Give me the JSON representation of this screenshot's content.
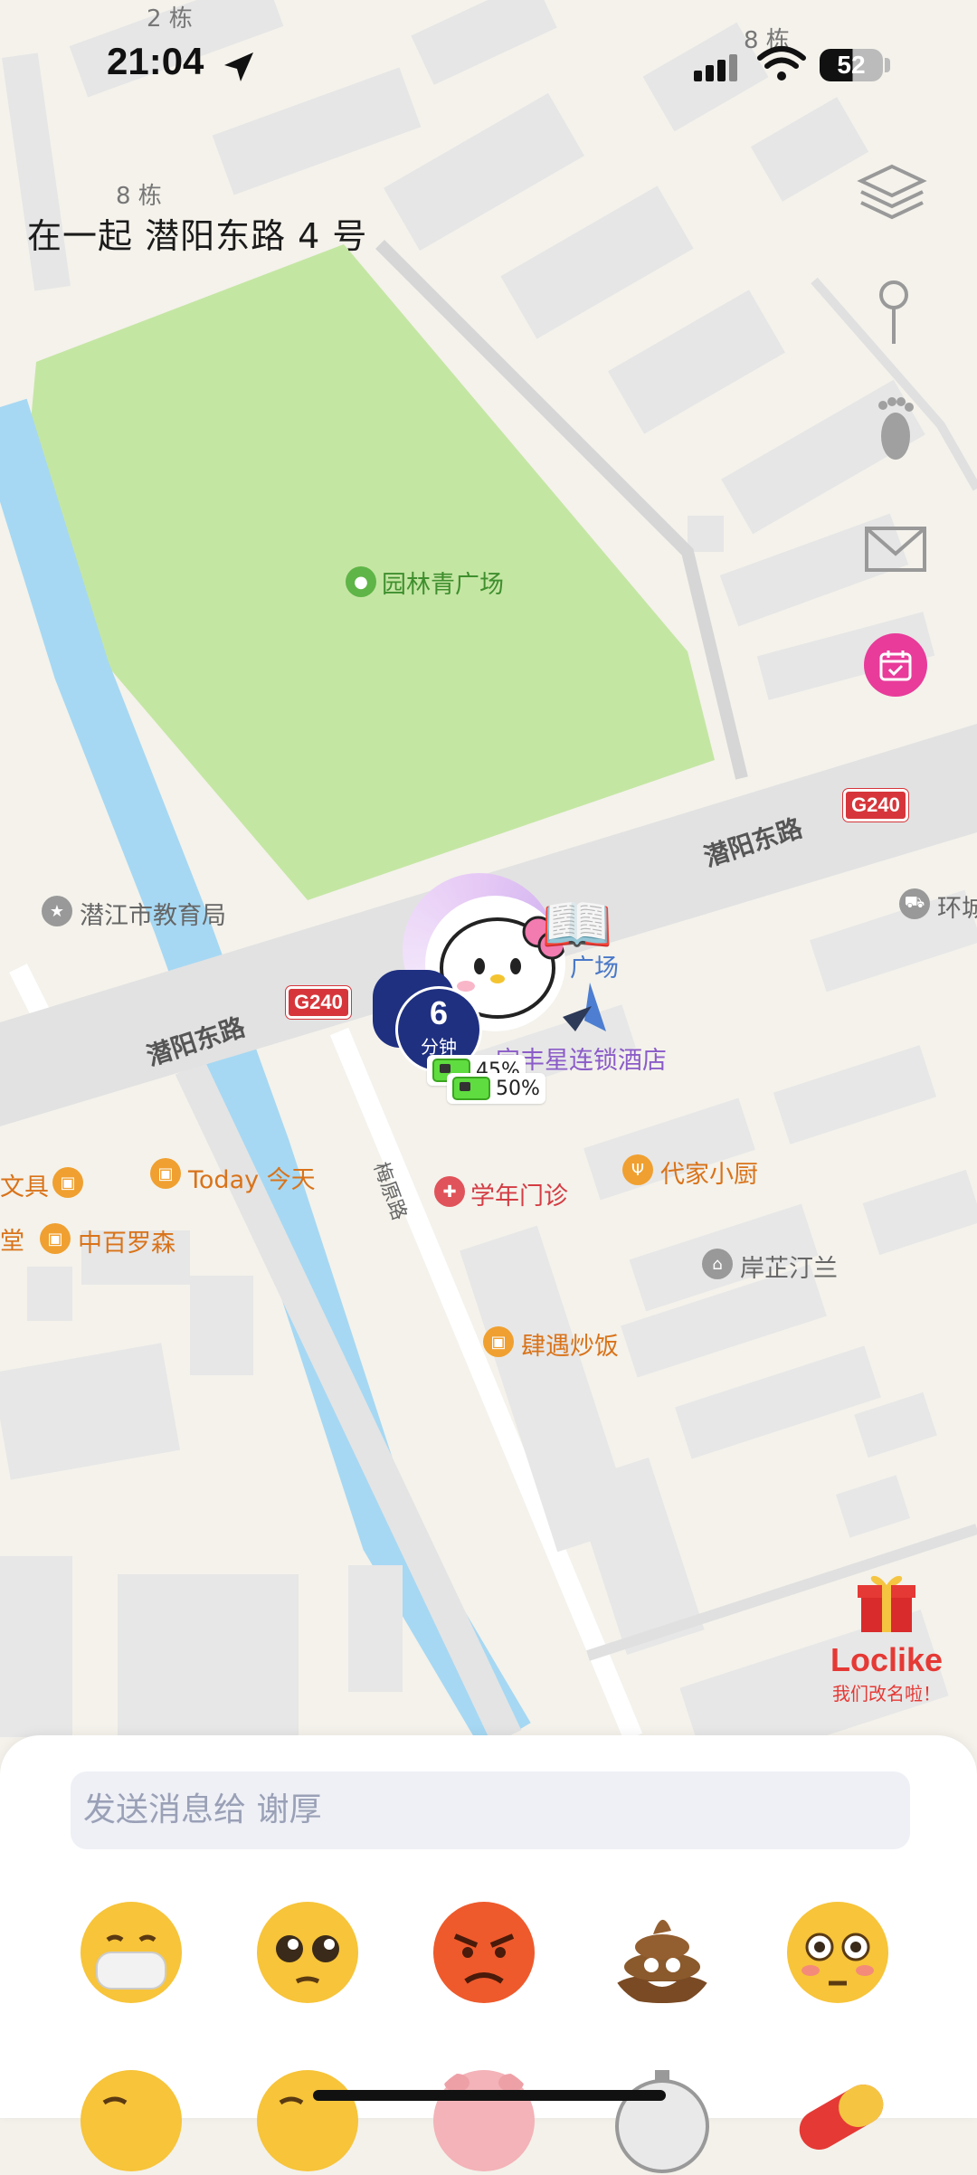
{
  "status_bar": {
    "time": "21:04",
    "battery": "52"
  },
  "address": "在一起 潜阳东路 4 号",
  "map_labels": {
    "building_top": "2 栋",
    "building_left": "8 栋",
    "building_right": "8 栋",
    "park": "园林青广场",
    "edu_bureau": "潜江市教育局",
    "road_main_right": "潜阳东路",
    "road_main_left": "潜阳东路",
    "g240_right": "G240",
    "g240_left": "G240",
    "side_road": "梅原路",
    "ring_partial": "环城",
    "hotel": "宜丰星连锁酒店",
    "square_partial": "广场",
    "today": "Today 今天",
    "stationery_partial": "文具",
    "zhongbai": "中百罗森",
    "clinic": "学年门诊",
    "kitchen": "代家小厨",
    "anzhi": "岸芷汀兰",
    "fried_rice": "肆遇炒饭",
    "partial_left": "堂"
  },
  "markers": {
    "time_value": "6",
    "time_unit": "分钟",
    "battery_back": "45%",
    "battery_front": "50%"
  },
  "promo": {
    "title": "Loclike",
    "subtitle": "我们改名啦！"
  },
  "message": {
    "placeholder": "发送消息给 谢厚"
  },
  "emojis": [
    "mask-face",
    "pleading-face",
    "angry-face",
    "poop",
    "flushed-face",
    "winking-face",
    "smiling-face",
    "pig-face",
    "stopwatch",
    "pill"
  ],
  "colors": {
    "park": "#c4e6a3",
    "river": "#a6d8f3",
    "road": "#e3e3e3",
    "accent_pink": "#e83b9a",
    "badge_blue": "#1f3081",
    "promo_red": "#e53935"
  }
}
